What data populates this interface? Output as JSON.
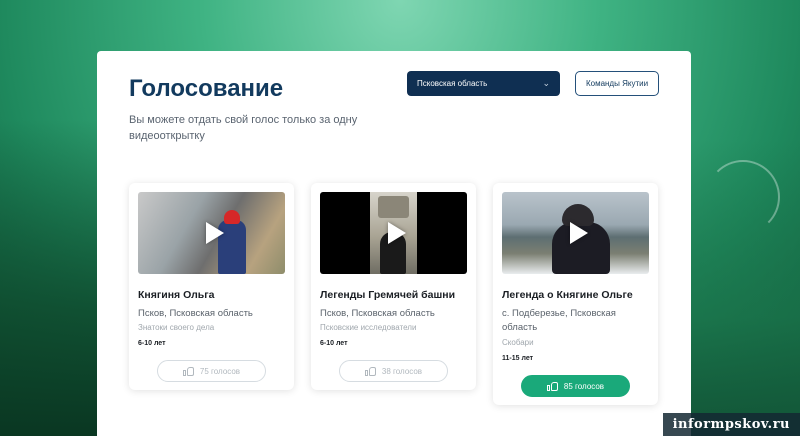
{
  "page": {
    "title": "Голосование",
    "subtitle": "Вы можете отдать свой голос только за одну видеооткрытку"
  },
  "filters": {
    "region_selected": "Псковская область",
    "team_button_label": "Команды Якутии"
  },
  "cards": [
    {
      "title": "Княгиня Ольга",
      "location": "Псков, Псковская область",
      "team": "Знатоки своего дела",
      "age": "6-10 лет",
      "votes_label": "75 голосов",
      "voted": false
    },
    {
      "title": "Легенды Гремячей башни",
      "location": "Псков, Псковская область",
      "team": "Псковские исследователи",
      "age": "6-10 лет",
      "votes_label": "38 голосов",
      "voted": false
    },
    {
      "title": "Легенда о Княгине Ольге",
      "location": "с. Подберезье, Псковская область",
      "team": "Скобари",
      "age": "11-15 лет",
      "votes_label": "85 голосов",
      "voted": true
    }
  ],
  "watermark": "informpskov.ru",
  "colors": {
    "accent_dark": "#0f2f52",
    "vote_active": "#1aa97a"
  },
  "icons": {
    "select": "chevron-down-icon",
    "video": "play-icon",
    "vote": "like-icon"
  }
}
